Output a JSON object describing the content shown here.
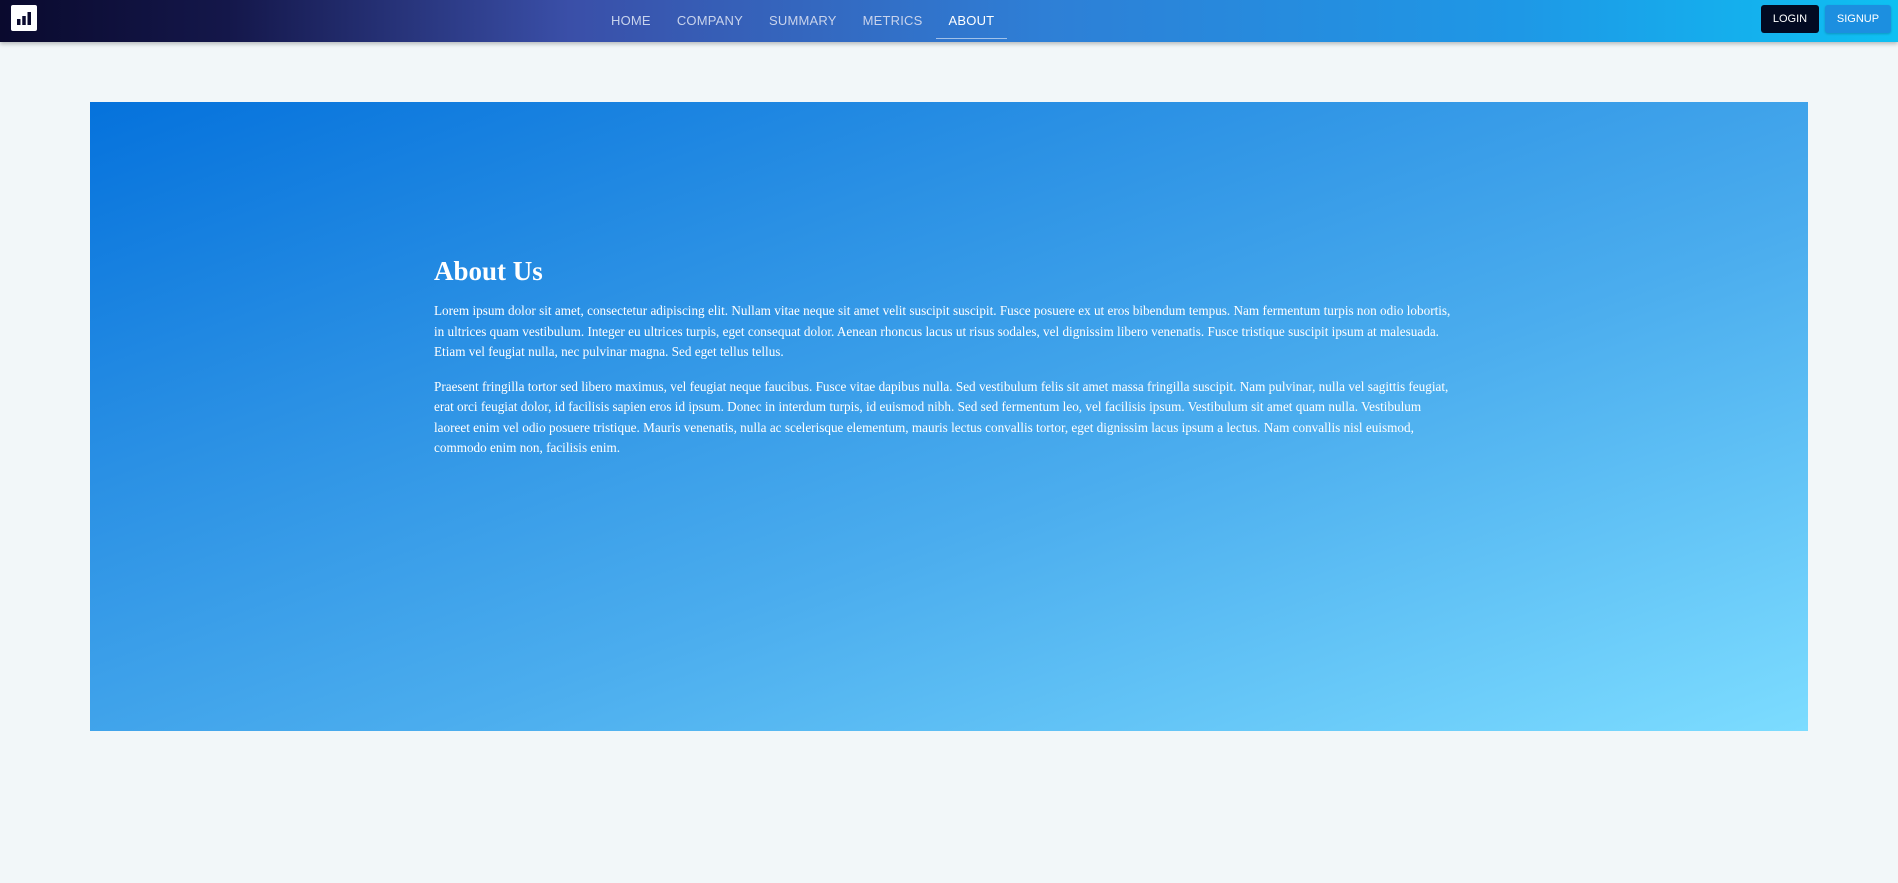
{
  "header": {
    "logo_icon": "bar-chart-icon",
    "nav": [
      {
        "label": "HOME",
        "active": false
      },
      {
        "label": "COMPANY",
        "active": false
      },
      {
        "label": "SUMMARY",
        "active": false
      },
      {
        "label": "METRICS",
        "active": false
      },
      {
        "label": "ABOUT",
        "active": true
      }
    ],
    "login_label": "LOGIN",
    "signup_label": "SIGNUP"
  },
  "about": {
    "title": "About Us",
    "paragraphs": [
      "Lorem ipsum dolor sit amet, consectetur adipiscing elit. Nullam vitae neque sit amet velit suscipit suscipit. Fusce posuere ex ut eros bibendum tempus. Nam fermentum turpis non odio lobortis, in ultrices quam vestibulum. Integer eu ultrices turpis, eget consequat dolor. Aenean rhoncus lacus ut risus sodales, vel dignissim libero venenatis. Fusce tristique suscipit ipsum at malesuada. Etiam vel feugiat nulla, nec pulvinar magna. Sed eget tellus tellus.",
      "Praesent fringilla tortor sed libero maximus, vel feugiat neque faucibus. Fusce vitae dapibus nulla. Sed vestibulum felis sit amet massa fringilla suscipit. Nam pulvinar, nulla vel sagittis feugiat, erat orci feugiat dolor, id facilisis sapien eros id ipsum. Donec in interdum turpis, id euismod nibh. Sed sed fermentum leo, vel facilisis ipsum. Vestibulum sit amet quam nulla. Vestibulum laoreet enim vel odio posuere tristique. Mauris venenatis, nulla ac scelerisque elementum, mauris lectus convallis tortor, eget dignissim lacus ipsum a lectus. Nam convallis nisl euismod, commodo enim non, facilisis enim."
    ]
  },
  "colors": {
    "page_background": "#f2f7f9",
    "login_button": "#020a22",
    "signup_button": "#1c8fe0",
    "hero_gradient_start": "#0572dc",
    "hero_gradient_end": "#7cdcff"
  }
}
